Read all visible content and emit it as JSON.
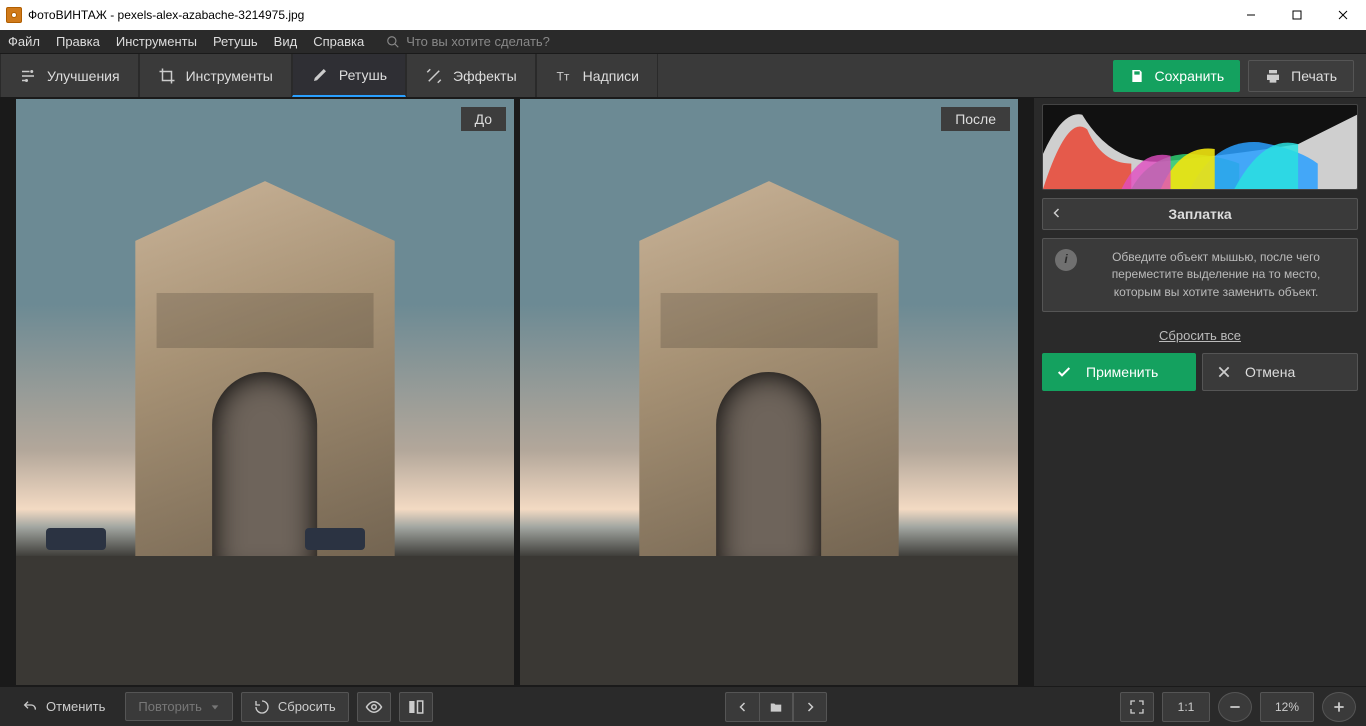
{
  "window": {
    "title": "ФотоВИНТАЖ - pexels-alex-azabache-3214975.jpg"
  },
  "menu": {
    "items": [
      "Файл",
      "Правка",
      "Инструменты",
      "Ретушь",
      "Вид",
      "Справка"
    ],
    "search_placeholder": "Что вы хотите сделать?"
  },
  "tabs": {
    "items": [
      {
        "label": "Улучшения",
        "icon": "sliders"
      },
      {
        "label": "Инструменты",
        "icon": "crop"
      },
      {
        "label": "Ретушь",
        "icon": "brush"
      },
      {
        "label": "Эффекты",
        "icon": "wand"
      },
      {
        "label": "Надписи",
        "icon": "text"
      }
    ],
    "active_index": 2
  },
  "top_actions": {
    "save": "Сохранить",
    "print": "Печать"
  },
  "compare": {
    "before": "До",
    "after": "После"
  },
  "panel": {
    "title": "Заплатка",
    "info": "Обведите объект мышью, после чего переместите выделение на то место, которым вы хотите заменить объект.",
    "reset": "Сбросить все",
    "apply": "Применить",
    "cancel": "Отмена"
  },
  "bottom": {
    "undo": "Отменить",
    "redo": "Повторить",
    "reset": "Сбросить",
    "ratio": "1:1",
    "zoom": "12%"
  }
}
